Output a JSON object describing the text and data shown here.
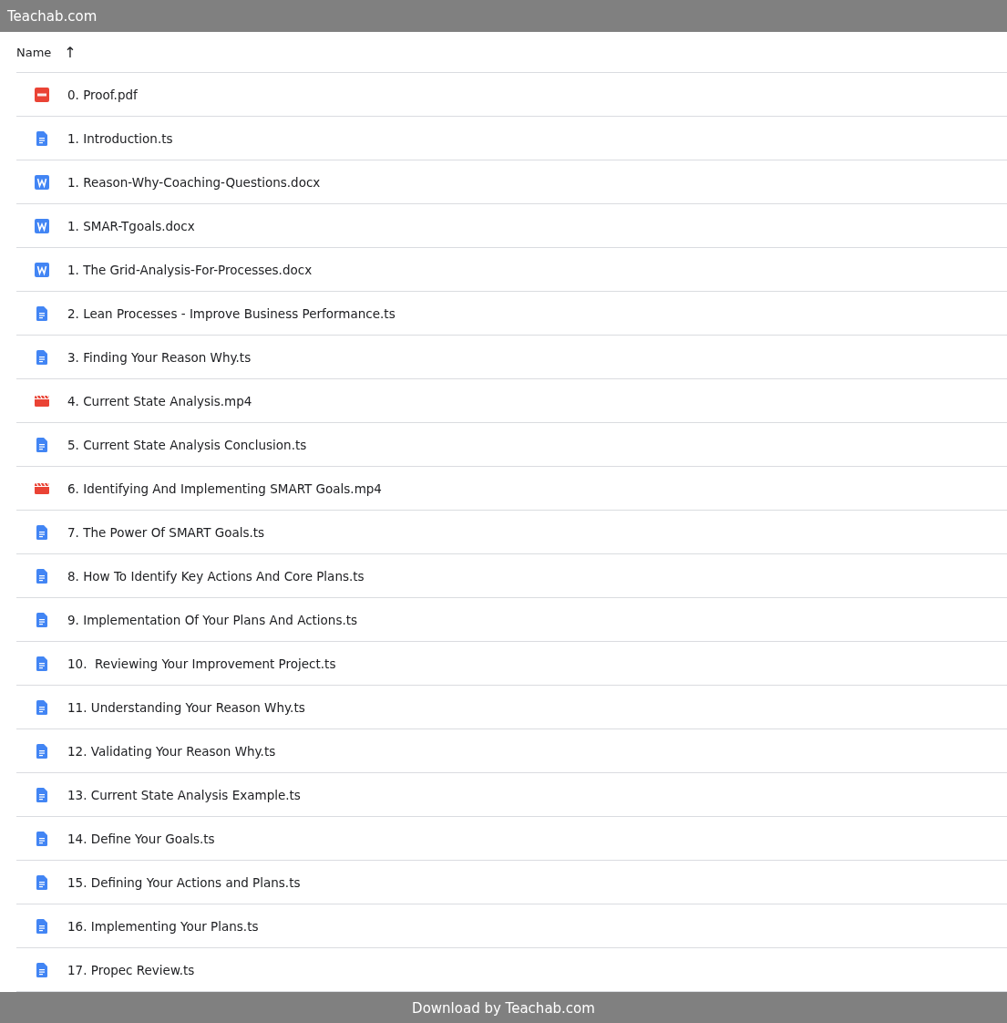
{
  "top_bar": {
    "title": "Teachab.com"
  },
  "table": {
    "columns": [
      {
        "label": "Name",
        "sort_icon": "↑"
      }
    ],
    "rows": [
      {
        "kind": "pdf",
        "name": "0. Proof.pdf"
      },
      {
        "kind": "doc",
        "name": "1. Introduction.ts"
      },
      {
        "kind": "word",
        "name": "1. Reason-Why-Coaching-Questions.docx"
      },
      {
        "kind": "word",
        "name": "1. SMAR-Tgoals.docx"
      },
      {
        "kind": "word",
        "name": "1. The Grid-Analysis-For-Processes.docx"
      },
      {
        "kind": "doc",
        "name": "2. Lean Processes - Improve Business Performance.ts"
      },
      {
        "kind": "doc",
        "name": "3. Finding Your Reason Why.ts"
      },
      {
        "kind": "video",
        "name": "4. Current State Analysis.mp4"
      },
      {
        "kind": "doc",
        "name": "5. Current State Analysis Conclusion.ts"
      },
      {
        "kind": "video",
        "name": "6. Identifying And Implementing SMART Goals.mp4"
      },
      {
        "kind": "doc",
        "name": "7. The Power Of SMART Goals.ts"
      },
      {
        "kind": "doc",
        "name": "8. How To Identify Key Actions And Core Plans.ts"
      },
      {
        "kind": "doc",
        "name": "9. Implementation Of Your Plans And Actions.ts"
      },
      {
        "kind": "doc",
        "name": "10.  Reviewing Your Improvement Project.ts"
      },
      {
        "kind": "doc",
        "name": "11. Understanding Your Reason Why.ts"
      },
      {
        "kind": "doc",
        "name": "12. Validating Your Reason Why.ts"
      },
      {
        "kind": "doc",
        "name": "13. Current State Analysis Example.ts"
      },
      {
        "kind": "doc",
        "name": "14. Define Your Goals.ts"
      },
      {
        "kind": "doc",
        "name": "15. Defining Your Actions and Plans.ts"
      },
      {
        "kind": "doc",
        "name": "16. Implementing Your Plans.ts"
      },
      {
        "kind": "doc",
        "name": "17. Propec Review.ts"
      }
    ]
  },
  "bottom_bar": {
    "text": "Download by Teachab.com"
  }
}
